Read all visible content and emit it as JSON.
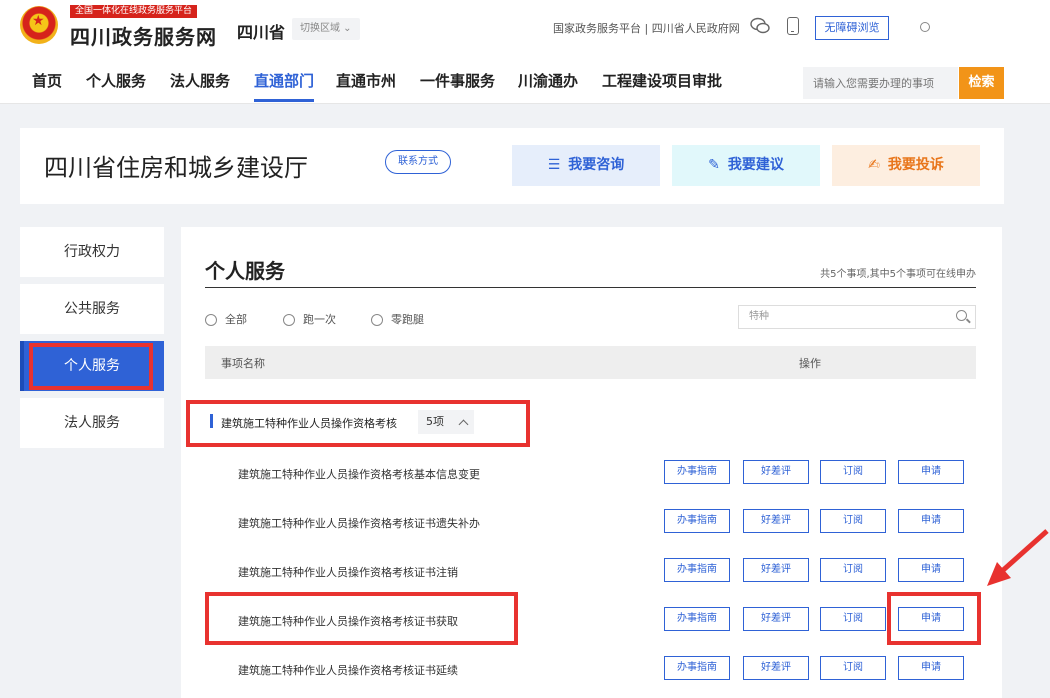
{
  "header": {
    "brand_tag": "全国一体化在线政务服务平台",
    "brand_name": "四川政务服务网",
    "province": "四川省",
    "switch_area": "切换区域 ⌄",
    "top_links": "国家政务服务平台 | 四川省人民政府网",
    "accessibility": "无障碍浏览",
    "user_glyph": "◎"
  },
  "nav": {
    "items": [
      "首页",
      "个人服务",
      "法人服务",
      "直通部门",
      "直通市州",
      "一件事服务",
      "川渝通办",
      "工程建设项目审批"
    ],
    "search_placeholder": "请输入您需要办理的事项",
    "search_button": "检索"
  },
  "department": {
    "title": "四川省住房和城乡建设厅",
    "contact": "联系方式",
    "actions": [
      {
        "label": "我要咨询",
        "icon": "☰"
      },
      {
        "label": "我要建议",
        "icon": "✎"
      },
      {
        "label": "我要投诉",
        "icon": "✍"
      }
    ]
  },
  "sidebar": {
    "items": [
      "行政权力",
      "公共服务",
      "个人服务",
      "法人服务"
    ]
  },
  "main": {
    "title": "个人服务",
    "stat": "共5个事项,其中5个事项可在线申办",
    "filters": [
      "全部",
      "跑一次",
      "零跑腿"
    ],
    "filter_placeholder": "特种",
    "columns": [
      "事项名称",
      "操作"
    ],
    "group": {
      "name": "建筑施工特种作业人员操作资格考核",
      "count": "5项"
    },
    "rows": [
      "建筑施工特种作业人员操作资格考核基本信息变更",
      "建筑施工特种作业人员操作资格考核证书遗失补办",
      "建筑施工特种作业人员操作资格考核证书注销",
      "建筑施工特种作业人员操作资格考核证书获取",
      "建筑施工特种作业人员操作资格考核证书延续"
    ],
    "ops": [
      "办事指南",
      "好差评",
      "订阅",
      "申请"
    ]
  },
  "colors": {
    "accent": "#2f62d6",
    "orange": "#f29418",
    "annotation": "#e8322f"
  }
}
